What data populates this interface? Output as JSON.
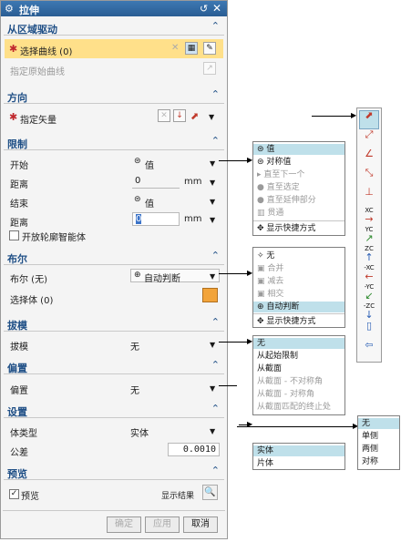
{
  "title": "拉伸",
  "sections": {
    "region": "从区域驱动",
    "direction": "方向",
    "limits": "限制",
    "boolean": "布尔",
    "draft": "拔模",
    "offset": "偏置",
    "settings": "设置",
    "preview": "预览"
  },
  "region": {
    "select_curve": "选择曲线 (0)",
    "specify_origin": "指定原始曲线"
  },
  "direction": {
    "specify_vector": "指定矢量"
  },
  "limits": {
    "start_label": "开始",
    "start_value": "值",
    "distance_label": "距离",
    "start_distance": "0",
    "unit1": "mm",
    "end_label": "结束",
    "end_value": "值",
    "end_distance_label": "距离",
    "end_distance": "0",
    "unit2": "mm",
    "open_profile": "开放轮廓智能体"
  },
  "boolean": {
    "label": "布尔 (无)",
    "value": "自动判断",
    "select_body": "选择体 (0)"
  },
  "draft": {
    "label": "拔模",
    "value": "无"
  },
  "offset": {
    "label": "偏置",
    "value": "无"
  },
  "settings": {
    "body_type_label": "体类型",
    "body_type_value": "实体",
    "tolerance_label": "公差",
    "tolerance_value": "0.0010"
  },
  "preview": {
    "checkbox": "预览",
    "show_result": "显示结果"
  },
  "buttons": {
    "ok": "确定",
    "apply": "应用",
    "cancel": "取消"
  },
  "limit_menu": [
    {
      "label": "值",
      "state": "selected"
    },
    {
      "label": "对称值",
      "state": "normal"
    },
    {
      "label": "直至下一个",
      "state": "dim"
    },
    {
      "label": "直至选定",
      "state": "dim"
    },
    {
      "label": "直至延伸部分",
      "state": "dim"
    },
    {
      "label": "贯通",
      "state": "dim"
    },
    {
      "label": "显示快捷方式",
      "state": "normal"
    }
  ],
  "bool_menu": [
    {
      "label": "无",
      "state": "normal"
    },
    {
      "label": "合并",
      "state": "dim"
    },
    {
      "label": "减去",
      "state": "dim"
    },
    {
      "label": "相交",
      "state": "dim"
    },
    {
      "label": "自动判断",
      "state": "selected"
    },
    {
      "label": "显示快捷方式",
      "state": "normal"
    }
  ],
  "draft_menu": [
    {
      "label": "无",
      "state": "selected"
    },
    {
      "label": "从起始限制",
      "state": "normal"
    },
    {
      "label": "从截面",
      "state": "normal"
    },
    {
      "label": "从截面 - 不对称角",
      "state": "dim"
    },
    {
      "label": "从截面 - 对称角",
      "state": "dim"
    },
    {
      "label": "从截面匹配的终止处",
      "state": "dim"
    }
  ],
  "offset_menu": [
    {
      "label": "无",
      "state": "selected"
    },
    {
      "label": "单侧",
      "state": "normal"
    },
    {
      "label": "两侧",
      "state": "normal"
    },
    {
      "label": "对称",
      "state": "normal"
    }
  ],
  "bodytype_menu": [
    {
      "label": "实体",
      "state": "selected"
    },
    {
      "label": "片体",
      "state": "normal"
    }
  ],
  "vector_tools": [
    {
      "name": "inferred-vector-icon",
      "label": "",
      "color": "#c0392b"
    },
    {
      "name": "two-points-icon",
      "label": "",
      "color": "#c0392b"
    },
    {
      "name": "angle-icon",
      "label": "",
      "color": "#c0392b"
    },
    {
      "name": "edge-axis-icon",
      "label": "",
      "color": "#c0392b"
    },
    {
      "name": "plane-normal-icon",
      "label": "",
      "color": "#c0392b"
    },
    {
      "name": "xc-axis-icon",
      "label": "XC",
      "color": "#c0392b"
    },
    {
      "name": "yc-axis-icon",
      "label": "YC",
      "color": "#2e8b2e"
    },
    {
      "name": "zc-axis-icon",
      "label": "ZC",
      "color": "#2b5fb5"
    },
    {
      "name": "neg-xc-axis-icon",
      "label": "-XC",
      "color": "#c0392b"
    },
    {
      "name": "neg-yc-axis-icon",
      "label": "-YC",
      "color": "#2e8b2e"
    },
    {
      "name": "neg-zc-axis-icon",
      "label": "-ZC",
      "color": "#2b5fb5"
    },
    {
      "name": "view-direction-icon",
      "label": "",
      "color": "#2b5fb5"
    },
    {
      "name": "back-arrow-icon",
      "label": "",
      "color": "#2b5fb5"
    }
  ]
}
